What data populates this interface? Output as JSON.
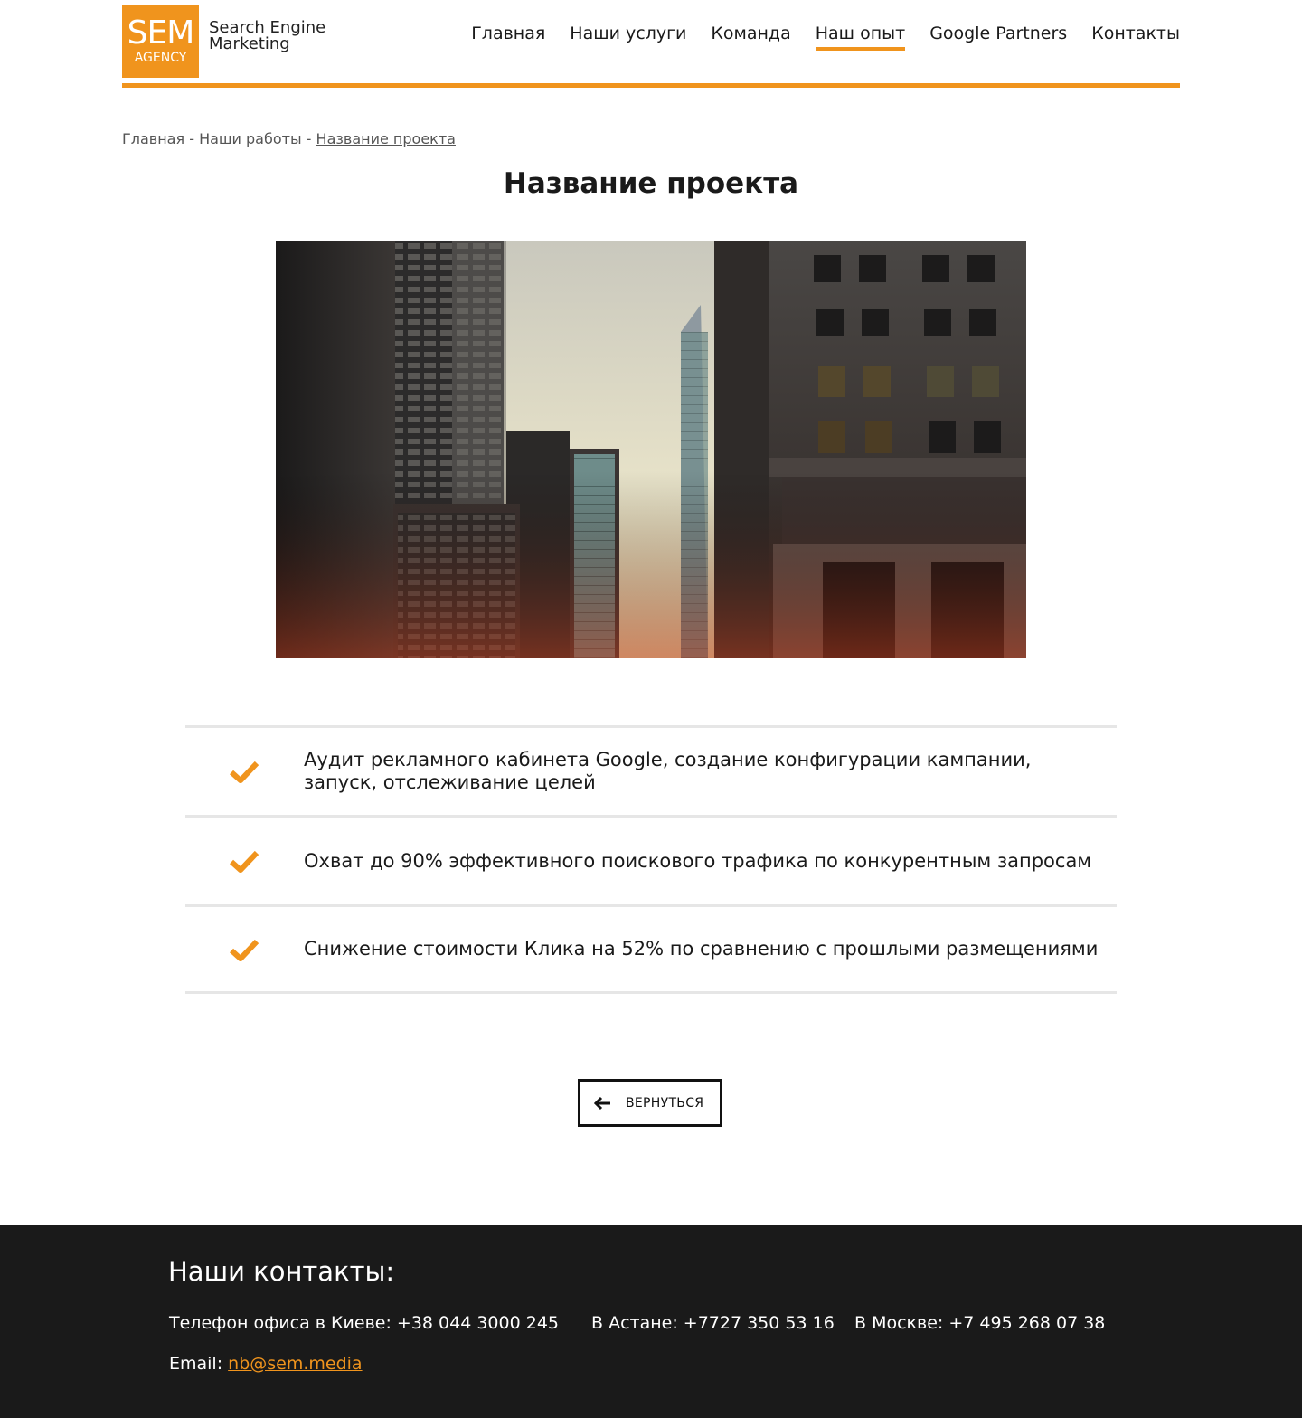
{
  "header": {
    "logo": {
      "big": "SEM",
      "small": "AGENCY",
      "line1": "Search Engine",
      "line2": "Marketing"
    },
    "nav": [
      {
        "label": "Главная"
      },
      {
        "label": "Наши услуги"
      },
      {
        "label": "Команда"
      },
      {
        "label": "Наш опыт",
        "active": true
      },
      {
        "label": "Google Partners"
      },
      {
        "label": "Контакты"
      }
    ],
    "accent_color": "#f0941d"
  },
  "breadcrumb": {
    "home": "Главная",
    "sep1": " - ",
    "works": "Наши работы",
    "sep2": " - ",
    "current": "Название проекта"
  },
  "main": {
    "title": "Название проекта",
    "features": [
      {
        "icon": "check-icon",
        "text": "Аудит рекламного кабинета Google, создание конфигурации кампании, запуск, отслеживание целей"
      },
      {
        "icon": "check-icon",
        "text": "Охват до 90% эффективного поискового трафика по конкурентным запросам"
      },
      {
        "icon": "check-icon",
        "text": "Снижение стоимости Клика на 52% по сравнению с прошлыми размещениями"
      }
    ],
    "back_button": {
      "icon": "arrow-left-icon",
      "label": "ВЕРНУТЬСЯ"
    }
  },
  "footer": {
    "title": "Наши контакты:",
    "phone_kyiv": "Телефон офиса в Киеве: +38 044 3000 245",
    "phone_astana": "В Астане: +7727 350 53 16",
    "phone_moscow": "В Москве: +7 495 268 07 38",
    "email_label": "Email: ",
    "email": "nb@sem.media",
    "background": "#1a1a1a"
  }
}
